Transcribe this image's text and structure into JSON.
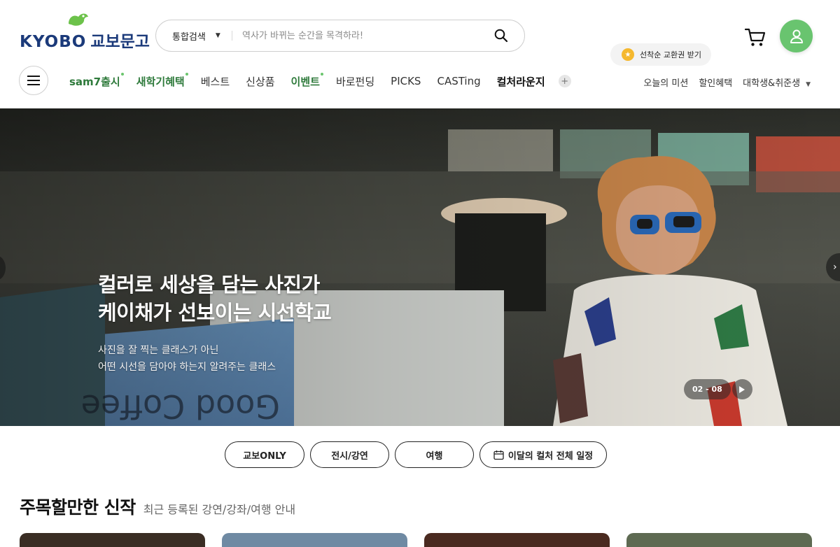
{
  "header": {
    "logo_text": "KYOBO",
    "logo_text_kr": "교보문고",
    "search": {
      "scope_label": "통합검색",
      "placeholder": "역사가 바뀌는 순간을 목격하라!"
    },
    "mission_bubble": "선착순 교환권 받기",
    "gnb": [
      {
        "label": "sam7출시",
        "style": "green",
        "dot": true
      },
      {
        "label": "새학기혜택",
        "style": "green",
        "dot": true
      },
      {
        "label": "베스트",
        "style": "normal",
        "dot": false
      },
      {
        "label": "신상품",
        "style": "normal",
        "dot": false
      },
      {
        "label": "이벤트",
        "style": "green",
        "dot": true
      },
      {
        "label": "바로펀딩",
        "style": "normal",
        "dot": false
      },
      {
        "label": "PICKS",
        "style": "normal",
        "dot": false
      },
      {
        "label": "CASTing",
        "style": "normal",
        "dot": false
      },
      {
        "label": "컬처라운지",
        "style": "bold",
        "dot": false
      }
    ],
    "util": {
      "mission": "오늘의 미션",
      "benefit": "할인혜택",
      "student": "대학생&취준생"
    }
  },
  "hero": {
    "title_line1": "컬러로 세상을 담는 사진가",
    "title_line2": "케이채가 선보이는 시선학교",
    "sub_line1": "사진을 잘 찍는 클래스가 아닌",
    "sub_line2": "어떤 시선을 담아야 하는지 알려주는 클래스",
    "pager": "02 - 08"
  },
  "chips": [
    {
      "label": "교보ONLY",
      "icon": null
    },
    {
      "label": "전시/강연",
      "icon": null
    },
    {
      "label": "여행",
      "icon": null
    },
    {
      "label": "이달의 컬처 전체 일정",
      "icon": "calendar-icon"
    }
  ],
  "section": {
    "title": "주목할만한 신작",
    "desc": "최근 등록된 강연/강좌/여행 안내"
  },
  "colors": {
    "brand_navy": "#1b3a7a",
    "brand_green": "#69c46f",
    "menu_green": "#2e7a3b"
  }
}
